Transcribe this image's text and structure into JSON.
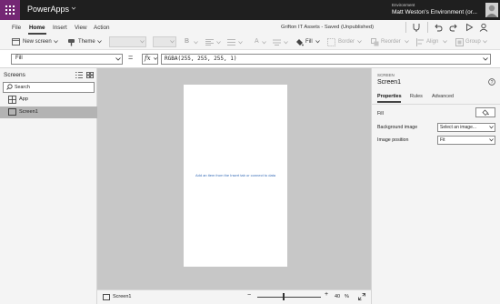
{
  "titlebar": {
    "app_name": "PowerApps",
    "environment_label": "Environment",
    "environment_name": "Matt Weston's Environment (or..."
  },
  "menu": {
    "items": [
      "File",
      "Home",
      "Insert",
      "View",
      "Action"
    ],
    "active": "Home",
    "document_title": "Grifton IT Assets - Saved (Unpublished)"
  },
  "toolbar": {
    "new_screen_label": "New screen",
    "theme_label": "Theme",
    "bold_label": "B",
    "fill_label": "Fill",
    "border_label": "Border",
    "reorder_label": "Reorder",
    "align_label": "Align",
    "group_label": "Group"
  },
  "formula_bar": {
    "property": "Fill",
    "equals": "=",
    "fx_label": "fx",
    "formula": "RGBA(255, 255, 255, 1)"
  },
  "left_panel": {
    "title": "Screens",
    "search_placeholder": "Search",
    "tree": [
      {
        "label": "App",
        "icon": "app-icon",
        "selected": false
      },
      {
        "label": "Screen1",
        "icon": "screen-icon",
        "selected": true
      }
    ]
  },
  "canvas": {
    "hint": "Add an item from the Insert tab or connect to data"
  },
  "status_bar": {
    "screen_label": "Screen1",
    "zoom_minus": "−",
    "zoom_plus": "+",
    "zoom_value": "40",
    "zoom_unit": "%",
    "zoom_fraction": 0.4
  },
  "right_panel": {
    "type_label": "SCREEN",
    "name": "Screen1",
    "tabs": [
      "Properties",
      "Rules",
      "Advanced"
    ],
    "active_tab": "Properties",
    "properties": {
      "fill_label": "Fill",
      "background_image_label": "Background image",
      "background_image_value": "Select an image...",
      "image_position_label": "Image position",
      "image_position_value": "Fit"
    }
  },
  "colors": {
    "accent_purple": "#742774",
    "titlebar": "#1f1f1f",
    "canvas_bg": "#c7c7c7",
    "hint_text": "#3a6fb8"
  }
}
